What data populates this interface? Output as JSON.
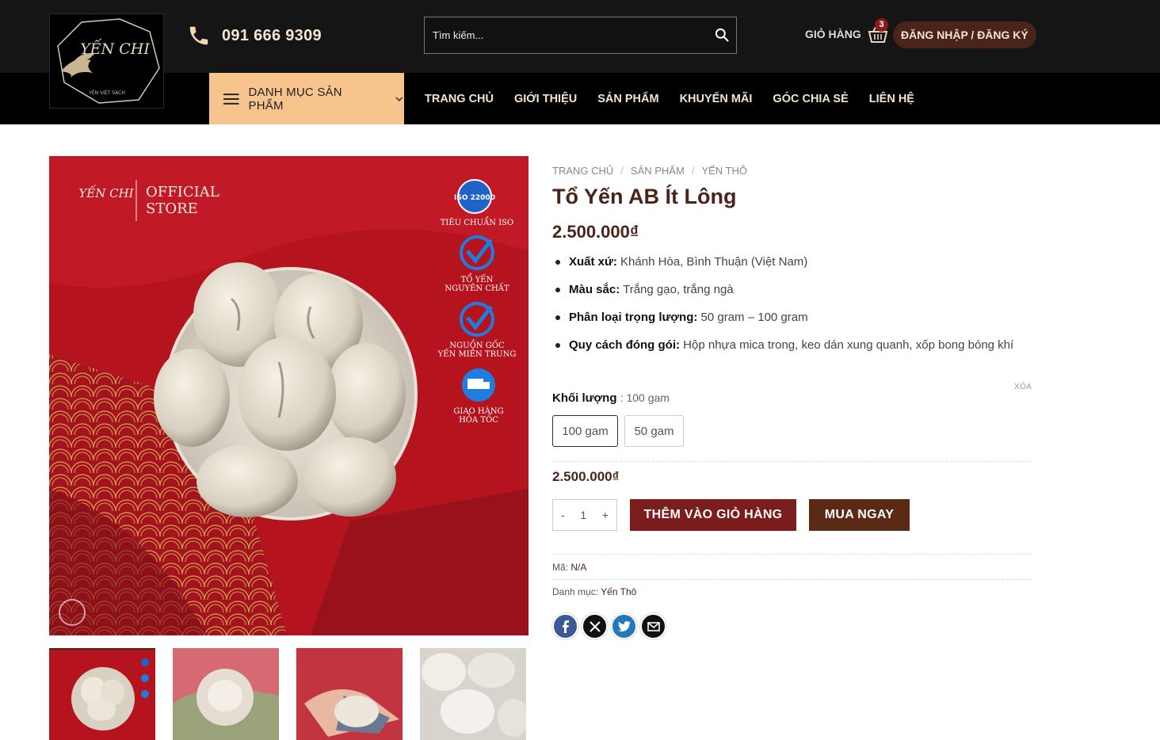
{
  "header": {
    "logo_name": "YẾN CHI",
    "logo_tagline": "YẾN VIỆT SẠCH",
    "phone": "091 666 9309",
    "search_placeholder": "Tìm kiếm...",
    "cart_label": "GIỎ HÀNG",
    "cart_count": "3",
    "login_label": "ĐĂNG NHẬP / ĐĂNG KÝ"
  },
  "nav": {
    "category_label": "DANH MỤC SẢN PHẨM",
    "items": [
      "TRANG CHỦ",
      "GIỚI THIỆU",
      "SẢN PHẨM",
      "KHUYẾN MÃI",
      "GÓC CHIA SẺ",
      "LIÊN HỆ"
    ]
  },
  "gallery": {
    "overlay_brand": "YẾN CHI",
    "overlay_store": [
      "OFFICIAL",
      "STORE"
    ],
    "badges": [
      {
        "text": [
          "TIÊU CHUẨN ISO"
        ],
        "seal": "ISO 22000"
      },
      {
        "text": [
          "TỔ YẾN",
          "NGUYÊN CHẤT"
        ]
      },
      {
        "text": [
          "NGUỒN GỐC",
          "YẾN MIỀN TRUNG"
        ]
      },
      {
        "text": [
          "GIAO HÀNG",
          "HỎA TỐC"
        ]
      }
    ]
  },
  "product": {
    "breadcrumb": [
      "TRANG CHỦ",
      "SẢN PHẨM",
      "YẾN THÔ"
    ],
    "title": "Tổ Yến AB Ít Lông",
    "price": "2.500.000₫",
    "specs": [
      {
        "label": "Xuất xứ:",
        "value": " Khánh Hòa, Bình Thuận (Việt Nam)"
      },
      {
        "label": "Màu sắc:",
        "value": " Trắng gạo, trắng ngà"
      },
      {
        "label": "Phân loại trọng lượng:",
        "value": " 50 gram – 100 gram"
      },
      {
        "label": "Quy cách đóng gói:",
        "value": " Hộp nhựa mica trong, keo dán xung quanh, xốp bong bóng khí"
      }
    ],
    "weight_label": "Khối lượng",
    "weight_value": ": 100 gam",
    "clear_label": "XÓA",
    "options": [
      "100 gam",
      "50 gam"
    ],
    "variant_price": "2.500.000₫",
    "qty_minus": "-",
    "qty": "1",
    "qty_plus": "+",
    "add_to_cart": "THÊM VÀO GIỎ HÀNG",
    "buy_now": "MUA NGAY",
    "sku_label": "Mã:",
    "sku_value": "N/A",
    "category_label": "Danh mục:",
    "category_value": "Yến Thô"
  },
  "colors": {
    "brand_brown": "#4a2418",
    "cart_red": "#7c1d1d",
    "category_bg": "#f7c48e",
    "facebook": "#3b5998",
    "x": "#111111",
    "twitter": "#2478ba",
    "email": "#111111"
  }
}
